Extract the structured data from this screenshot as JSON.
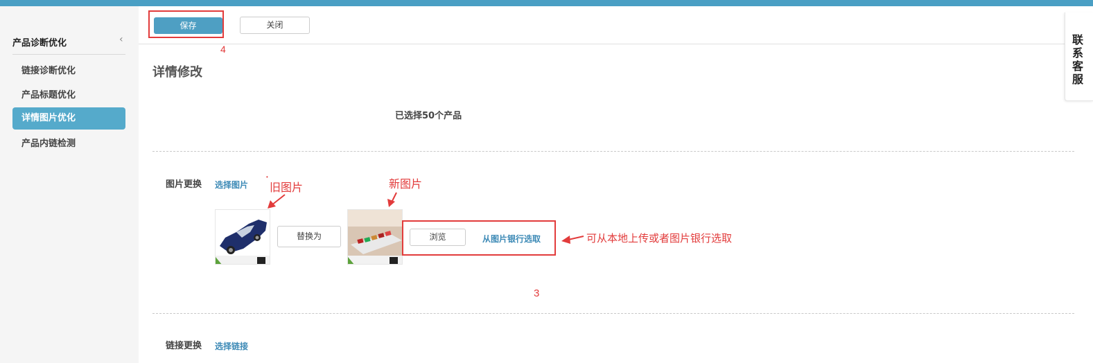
{
  "sidebar": {
    "title": "产品诊断优化",
    "collapse_icon": "‹",
    "items": [
      {
        "label": "链接诊断优化",
        "active": false
      },
      {
        "label": "产品标题优化",
        "active": false
      },
      {
        "label": "详情图片优化",
        "active": true
      },
      {
        "label": "产品内链检测",
        "active": false
      }
    ]
  },
  "toolbar": {
    "save_label": "保存",
    "close_label": "关闭"
  },
  "main": {
    "title": "详情修改",
    "selected_count": "已选择50个产品",
    "image_replace": {
      "label": "图片更换",
      "select_link": "选择图片",
      "replace_button": "替换为",
      "browse_button": "浏览",
      "bank_link": "从图片银行选取"
    },
    "link_replace": {
      "label": "链接更换",
      "select_link": "选择链接"
    }
  },
  "annotations": {
    "step4": "4",
    "step3": "3",
    "old_image": "旧图片",
    "new_image": "新图片",
    "upload_hint": "可从本地上传或者图片银行选取"
  },
  "customer_service": {
    "label": "联系客服"
  },
  "colors": {
    "topbar": "#4a9fc4",
    "accent": "#4e9fc3",
    "annotation": "#e23b3b",
    "link": "#3d8ab6"
  }
}
